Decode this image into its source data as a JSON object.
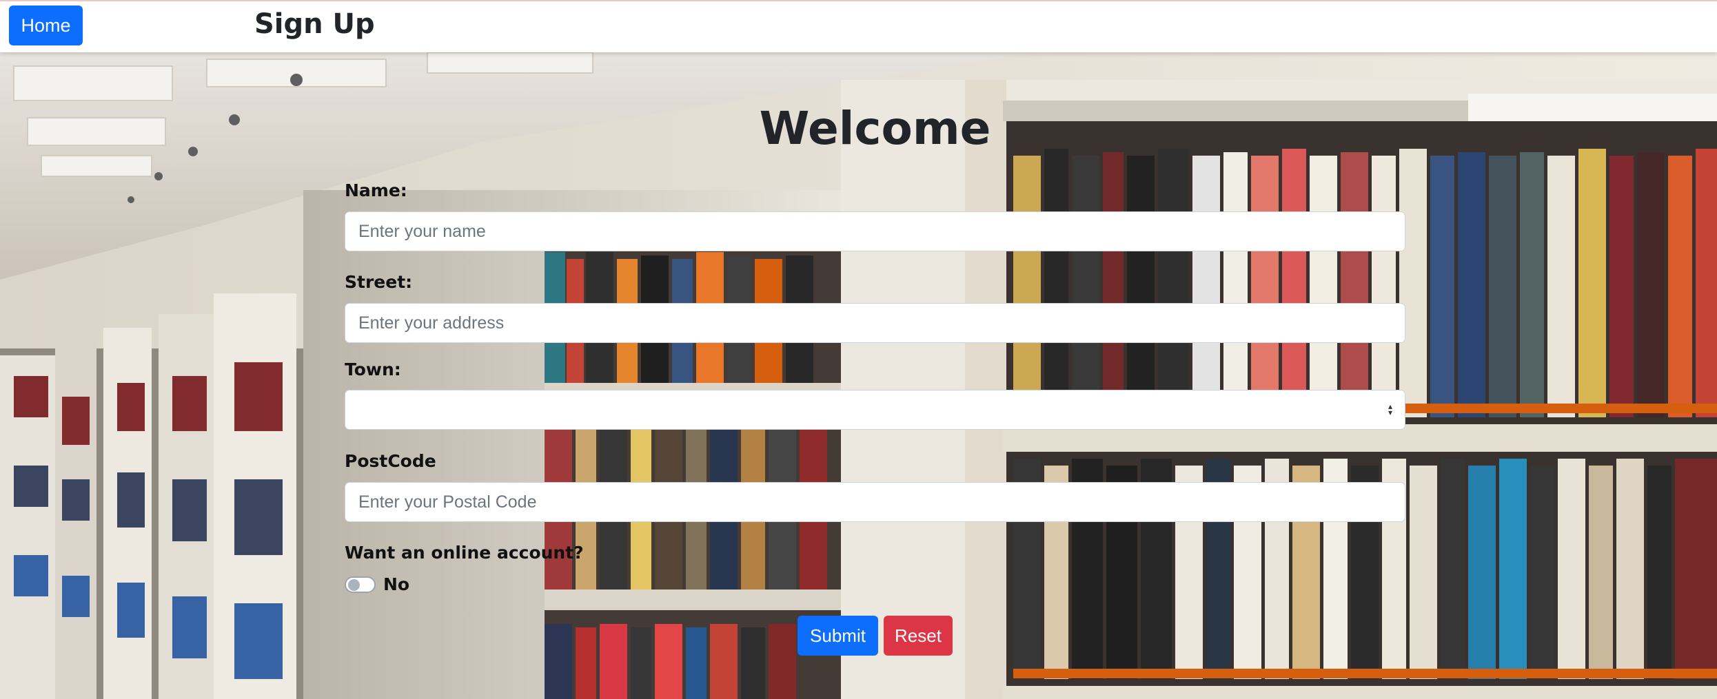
{
  "nav": {
    "home_label": "Home",
    "page_title": "Sign Up"
  },
  "form": {
    "heading": "Welcome",
    "name": {
      "label": "Name:",
      "placeholder": "Enter your name",
      "value": ""
    },
    "street": {
      "label": "Street:",
      "placeholder": "Enter your address",
      "value": ""
    },
    "town": {
      "label": "Town:",
      "selected": ""
    },
    "postcode": {
      "label": "PostCode",
      "placeholder": "Enter your Postal Code",
      "value": ""
    },
    "online_account": {
      "label": "Want an online account?",
      "toggle_text": "No",
      "checked": false
    },
    "submit_label": "Submit",
    "reset_label": "Reset"
  },
  "icons": {
    "select_arrow": "sort-arrows-icon",
    "background": "library-bookshelves-photo"
  },
  "colors": {
    "primary": "#0d6efd",
    "danger": "#dc3545",
    "text": "#212529"
  }
}
